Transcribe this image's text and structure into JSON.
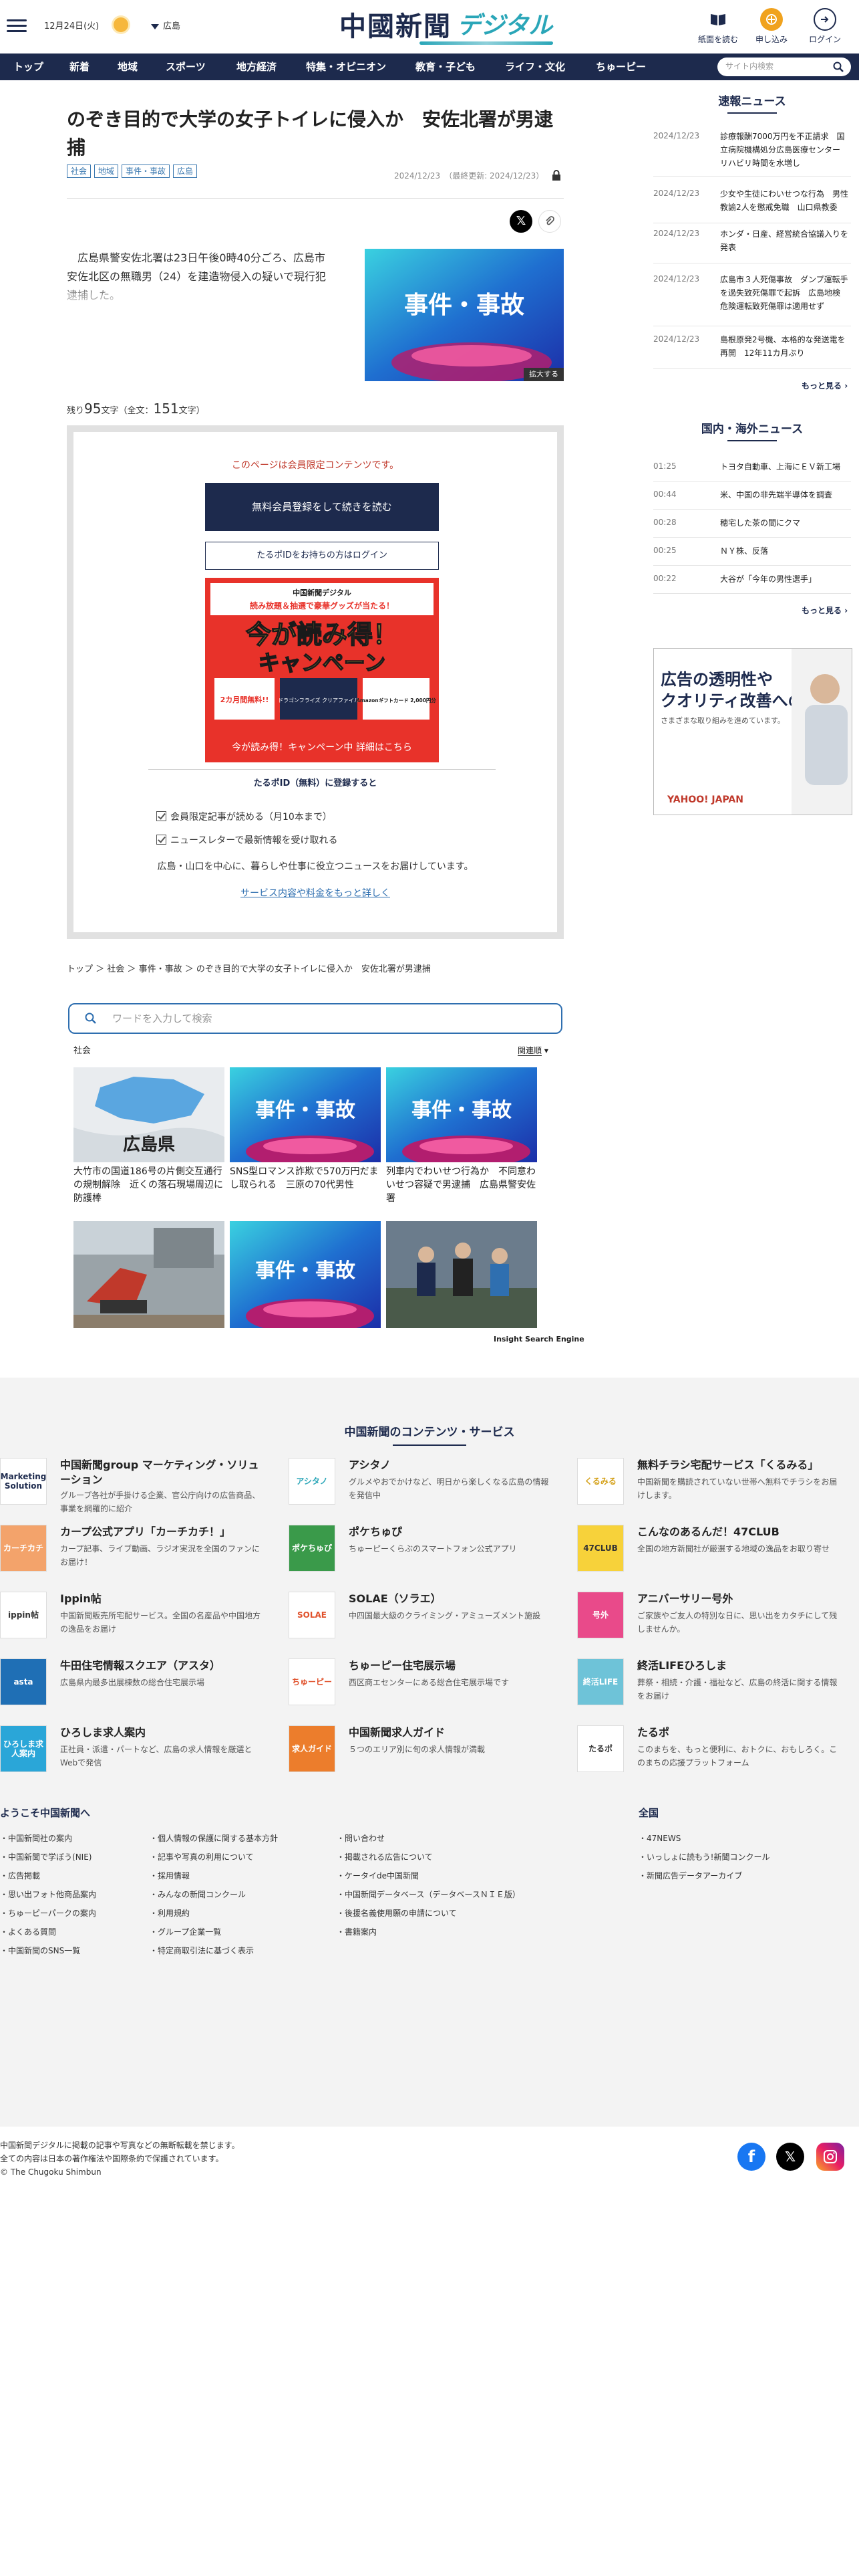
{
  "header": {
    "date": "12月24日(火)",
    "region": "広島",
    "logo_main": "中國新聞",
    "logo_sub": "デジタル",
    "buttons": [
      {
        "label": "紙面を読む"
      },
      {
        "label": "申し込み"
      },
      {
        "label": "ログイン"
      }
    ]
  },
  "nav": {
    "items": [
      "トップ",
      "新着",
      "地域",
      "スポーツ",
      "地方経済",
      "特集・オピニオン",
      "教育・子ども",
      "ライフ・文化",
      "ちゅーピー"
    ],
    "search_placeholder": "サイト内検索"
  },
  "article": {
    "title": "のぞき目的で大学の女子トイレに侵入か　安佐北署が男逮捕",
    "tags": [
      "社会",
      "地域",
      "事件・事故",
      "広島"
    ],
    "date": "2024/12/23",
    "updated": "（最終更新: 2024/12/23）",
    "lead": "広島県警安佐北署は23日午後0時40分ごろ、広島市安佐北区の無職男（24）を建造物侵入の疑いで現行犯逮捕した。",
    "image_text": "事件・事故",
    "zoom_label": "拡大する",
    "remain_prefix": "残り",
    "remain_num": "95",
    "remain_mid": "文字（全文：",
    "total_num": "151",
    "remain_suffix": "文字）"
  },
  "paywall": {
    "message": "このページは会員限定コンテンツです。",
    "register_button": "無料会員登録をして続きを読む",
    "login_button": "たるポIDをお持ちの方はログイン",
    "campaign_top": "中国新聞デジタル",
    "campaign_line": "読み放題＆抽選で豪華グッズが当たる！",
    "campaign_title": "今が読み得！",
    "campaign_title2": "キャンペーン",
    "campaign_badge": "2カ月間無料!!",
    "campaign_gift1": "ドラゴンフライズ クリアファイル",
    "campaign_gift2": "Amazonギフトカード 2,000円分",
    "campaign_bottom": "今が読み得！キャンペーン中 詳細はこちら",
    "tarobo_title": "たるポID（無料）に登録すると",
    "benefits": [
      "会員限定記事が読める（月10本まで）",
      "ニュースレターで最新情報を受け取れる"
    ],
    "benefit_text": "広島・山口を中心に、暮らしや仕事に役立つニュースをお届けしています。",
    "more_link": "サービス内容や料金をもっと詳しく"
  },
  "breadcrumb": [
    "トップ",
    "社会",
    "事件・事故",
    "のぞき目的で大学の女子トイレに侵入か　安佐北署が男逮捕"
  ],
  "search": {
    "placeholder": "ワードを入力して検索"
  },
  "related": {
    "category": "社会",
    "sort": "関連順",
    "items": [
      {
        "img": "広島県",
        "caption": "大竹市の国道186号の片側交互通行の規制解除　近くの落石現場周辺に防護棒"
      },
      {
        "img": "事件・事故",
        "caption": "SNS型ロマンス詐欺で570万円だまし取られる　三原の70代男性"
      },
      {
        "img": "事件・事故",
        "caption": "列車内でわいせつ行為か　不同意わいせつ容疑で男逮捕　広島県警安佐署"
      },
      {
        "img": "",
        "caption": ""
      },
      {
        "img": "事件・事故",
        "caption": ""
      },
      {
        "img": "",
        "caption": ""
      }
    ],
    "engine": "Insight Search Engine"
  },
  "sidebar": {
    "breaking_title": "速報ニュース",
    "breaking": [
      {
        "date": "2024/12/23",
        "text": "診療報酬7000万円を不正請求　国立病院機構処分広島医療センター　リハビリ時間を水増し"
      },
      {
        "date": "2024/12/23",
        "text": "少女や生徒にわいせつな行為　男性教諭2人を懲戒免職　山口県教委"
      },
      {
        "date": "2024/12/23",
        "text": "ホンダ・日産、経営統合協議入りを発表"
      },
      {
        "date": "2024/12/23",
        "text": "広島市３人死傷事故　ダンプ運転手を過失致死傷罪で起訴　広島地検　危険運転致死傷罪は適用せず"
      },
      {
        "date": "2024/12/23",
        "text": "島根原発2号機、本格的な発送電を再開　12年11カ月ぶり"
      }
    ],
    "more": "もっと見る",
    "world_title": "国内・海外ニュース",
    "world": [
      {
        "date": "01:25",
        "text": "トヨタ自動車、上海にＥＶ新工場"
      },
      {
        "date": "00:44",
        "text": "米、中国の非先端半導体を調査"
      },
      {
        "date": "00:28",
        "text": "穂宅した茶の間にクマ"
      },
      {
        "date": "00:25",
        "text": "ＮＹ株、反落"
      },
      {
        "date": "00:22",
        "text": "大谷が「今年の男性選手」"
      }
    ],
    "ad_line1": "広告の透明性や",
    "ad_line2": "クオリティ改善への",
    "ad_line3": "さまざまな取り組みを進めています。",
    "ad_logo": "YAHOO! JAPAN"
  },
  "services": {
    "title": "中国新聞のコンテンツ・サービス",
    "items": [
      {
        "name": "中国新聞group マーケティング・ソリューション",
        "desc": "グループ各社が手掛ける企業、官公庁向けの広告商品、事業を網羅的に紹介",
        "logo": "Marketing Solution",
        "color": "#ffffff",
        "fg": "#1d2a4d"
      },
      {
        "name": "アシタノ",
        "desc": "グルメやおでかけなど、明日から楽しくなる広島の情報を発信中",
        "logo": "アシタノ",
        "color": "#ffffff",
        "fg": "#2aa6b8"
      },
      {
        "name": "無料チラシ宅配サービス「くるみる」",
        "desc": "中国新聞を購読されていない世帯へ無料でチラシをお届けします。",
        "logo": "くるみる",
        "color": "#ffffff",
        "fg": "#d4a017"
      },
      {
        "name": "カープ公式アプリ「カーチカチ！」",
        "desc": "カープ記事、ライブ動画、ラジオ実況を全国のファンにお届け！",
        "logo": "カーチカチ",
        "color": "#f3a36b",
        "fg": "#ffffff"
      },
      {
        "name": "ポケちゅぴ",
        "desc": "ちゅーピーくらぶのスマートフォン公式アプリ",
        "logo": "ポケちゅぴ",
        "color": "#3a9a4a",
        "fg": "#ffffff"
      },
      {
        "name": "こんなのあるんだ！47CLUB",
        "desc": "全国の地方新聞社が厳選する地域の逸品をお取り寄せ",
        "logo": "47CLUB",
        "color": "#f7d23a",
        "fg": "#333333"
      },
      {
        "name": "Ippin帖",
        "desc": "中国新聞販売所宅配サービス。全国の名産品や中国地方の逸品をお届け",
        "logo": "ippin帖",
        "color": "#ffffff",
        "fg": "#333333"
      },
      {
        "name": "SOLAE（ソラエ）",
        "desc": "中四国最大級のクライミング・アミューズメント施設",
        "logo": "SOLAE",
        "color": "#ffffff",
        "fg": "#e0502a"
      },
      {
        "name": "アニバーサリー号外",
        "desc": "ご家族やご友人の特別な日に、思い出をカタチにして残しませんか。",
        "logo": "号外",
        "color": "#e94a8a",
        "fg": "#ffffff"
      },
      {
        "name": "牛田住宅情報スクエア（アスタ）",
        "desc": "広島県内最多出展棟数の総合住宅展示場",
        "logo": "asta",
        "color": "#1f6fb5",
        "fg": "#ffffff"
      },
      {
        "name": "ちゅーピー住宅展示場",
        "desc": "西区商エセンターにある総合住宅展示場です",
        "logo": "ちゅーピー",
        "color": "#ffffff",
        "fg": "#e0502a"
      },
      {
        "name": "終活LIFEひろしま",
        "desc": "葬祭・相続・介護・福祉など、広島の終活に関する情報をお届け",
        "logo": "終活LIFE",
        "color": "#6ec3d8",
        "fg": "#ffffff"
      },
      {
        "name": "ひろしま求人案内",
        "desc": "正社員・派遣・パートなど、広島の求人情報を厳選と Webで発信",
        "logo": "ひろしま求人案内",
        "color": "#2aa6d8",
        "fg": "#ffffff"
      },
      {
        "name": "中国新聞求人ガイド",
        "desc": "５つのエリア別に旬の求人情報が満載",
        "logo": "求人ガイド",
        "color": "#ec7d2c",
        "fg": "#ffffff"
      },
      {
        "name": "たるポ",
        "desc": "このまちを、もっと便利に、おトクに、おもしろく。このまちの応援プラットフォーム",
        "logo": "たるポ",
        "color": "#ffffff",
        "fg": "#333333"
      }
    ]
  },
  "footer": {
    "welcome": "ようこそ中国新聞へ",
    "col1": [
      "中国新聞社の案内",
      "中国新聞で学ぼう(NIE)",
      "広告掲載",
      "思い出フォト他商品案内",
      "ちゅーピーパークの案内",
      "よくある質問",
      "中国新聞のSNS一覧"
    ],
    "col2": [
      "個人情報の保護に関する基本方針",
      "記事や写真の利用について",
      "採用情報",
      "みんなの新聞コンクール",
      "利用規約",
      "グループ企業一覧",
      "特定商取引法に基づく表示"
    ],
    "col3": [
      "問い合わせ",
      "掲載される広告について",
      "ケータイde中国新聞",
      "中国新聞データベース（データベースＮＩＥ版）",
      "後援名義使用願の申請について",
      "書籍案内"
    ],
    "national": "全国",
    "col4": [
      "47NEWS",
      "いっしょに読もう!新聞コンクール",
      "新聞広告データアーカイブ"
    ],
    "copy1": "中国新聞デジタルに掲載の記事や写真などの無断転載を禁じます。",
    "copy2": "全ての内容は日本の著作権法や国際条約で保護されています。",
    "copy3": "© The Chugoku Shimbun"
  },
  "colors": {
    "navy": "#1d2a4d",
    "accent": "#2aa6b8",
    "link": "#2f6fb0",
    "alert": "#c0392b"
  }
}
